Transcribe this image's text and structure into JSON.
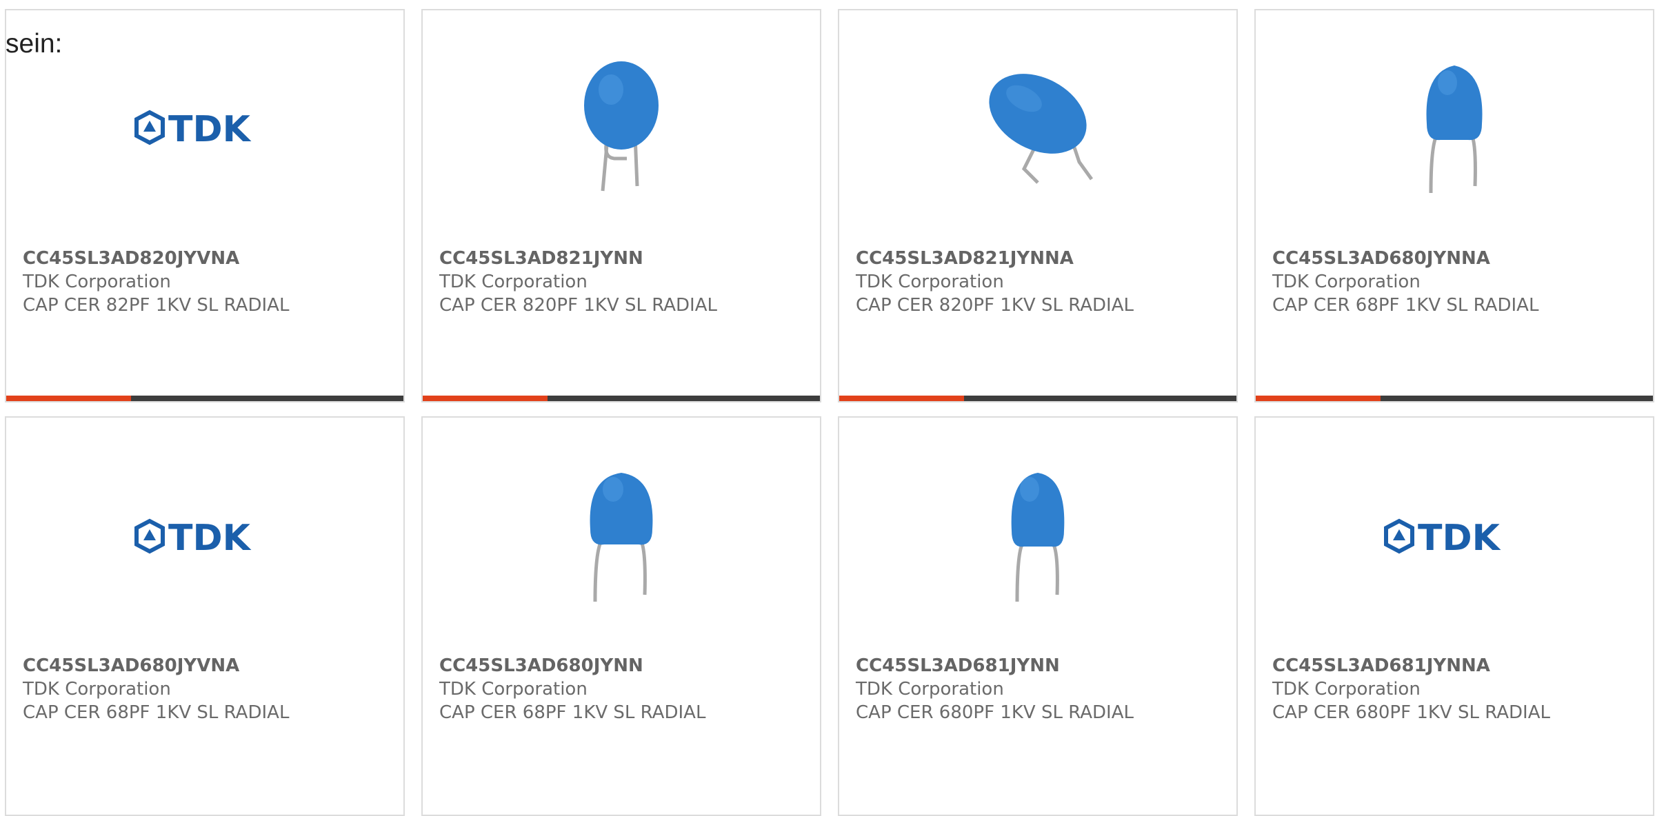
{
  "intro_text": "sein:",
  "colors": {
    "accent": "#e2411a",
    "bar_dark": "#3d3d3d",
    "tdk_blue": "#1b5fab",
    "capacitor_blue": "#2f80cf"
  },
  "products": [
    {
      "part": "CC45SL3AD820JYVNA",
      "manufacturer": "TDK Corporation",
      "description": "CAP CER 82PF 1KV SL RADIAL",
      "image": "tdk-logo"
    },
    {
      "part": "CC45SL3AD821JYNN",
      "manufacturer": "TDK Corporation",
      "description": "CAP CER 820PF 1KV SL RADIAL",
      "image": "capacitor-photo"
    },
    {
      "part": "CC45SL3AD821JYNNA",
      "manufacturer": "TDK Corporation",
      "description": "CAP CER 820PF 1KV SL RADIAL",
      "image": "capacitor-photo-tilted"
    },
    {
      "part": "CC45SL3AD680JYNNA",
      "manufacturer": "TDK Corporation",
      "description": "CAP CER 68PF 1KV SL RADIAL",
      "image": "capacitor-photo"
    },
    {
      "part": "CC45SL3AD680JYVNA",
      "manufacturer": "TDK Corporation",
      "description": "CAP CER 68PF 1KV SL RADIAL",
      "image": "tdk-logo"
    },
    {
      "part": "CC45SL3AD680JYNN",
      "manufacturer": "TDK Corporation",
      "description": "CAP CER 68PF 1KV SL RADIAL",
      "image": "capacitor-photo"
    },
    {
      "part": "CC45SL3AD681JYNN",
      "manufacturer": "TDK Corporation",
      "description": "CAP CER 680PF 1KV SL RADIAL",
      "image": "capacitor-photo"
    },
    {
      "part": "CC45SL3AD681JYNNA",
      "manufacturer": "TDK Corporation",
      "description": "CAP CER 680PF 1KV SL RADIAL",
      "image": "tdk-logo"
    }
  ]
}
